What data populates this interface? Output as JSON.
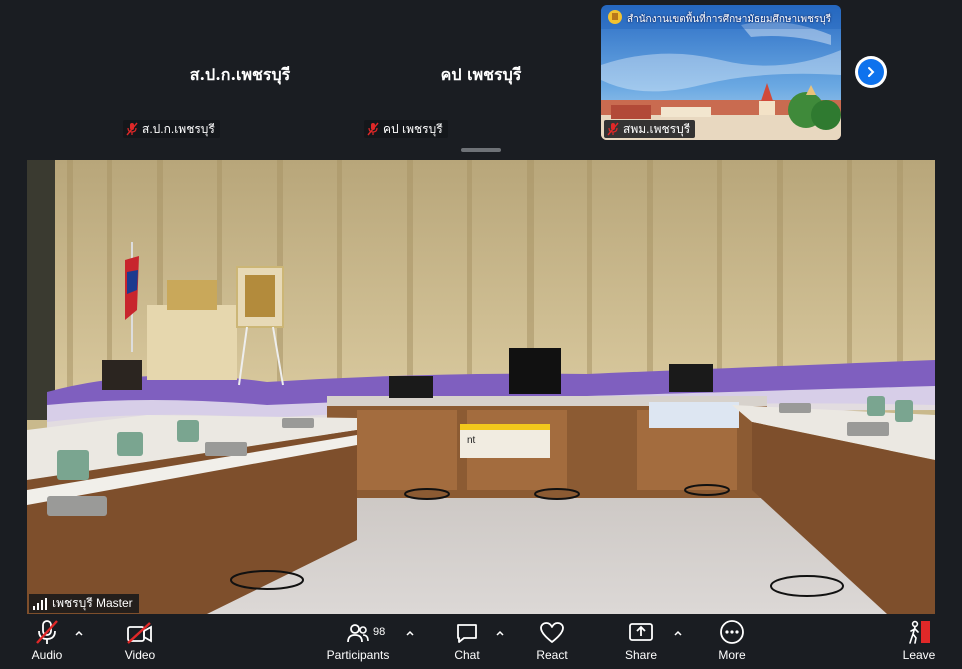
{
  "participants_strip": {
    "tiles": [
      {
        "display_name": "ส.ป.ก.เพชรบุรี",
        "tag": "ส.ป.ก.เพชรบุรี",
        "muted": true
      },
      {
        "display_name": "คป เพชรบุรี",
        "tag": "คป เพชรบุรี",
        "muted": true
      },
      {
        "banner_text": "สำนักงานเขตพื้นที่การศึกษามัธยมศึกษาเพชรบุรี",
        "tag": "สพม.เพชรบุรี",
        "muted": true
      }
    ]
  },
  "main_video": {
    "speaker_tag": "เพชรบุรี Master",
    "sign_text": "nt"
  },
  "toolbar": {
    "audio_label": "Audio",
    "video_label": "Video",
    "participants_label": "Participants",
    "participants_count": "98",
    "chat_label": "Chat",
    "react_label": "React",
    "share_label": "Share",
    "more_label": "More",
    "leave_label": "Leave"
  },
  "colors": {
    "background": "#1a1d22",
    "muted_red": "#e02828",
    "accent_blue": "#0e72ed",
    "leave_red": "#e02828"
  }
}
